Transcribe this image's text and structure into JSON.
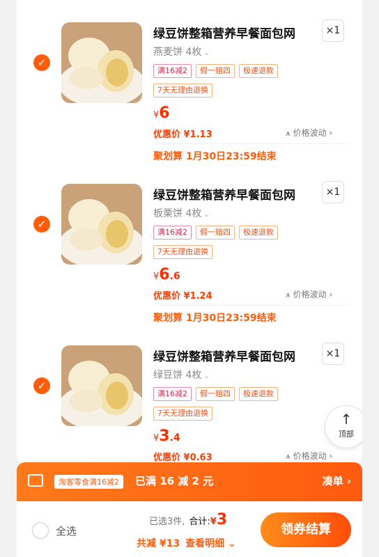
{
  "items": [
    {
      "title": "绿豆饼整箱营养早餐面包网",
      "qty": "×1",
      "variant": "燕麦饼 4枚",
      "tags": [
        "满16减2",
        "假一赔四",
        "极速退款"
      ],
      "return_tag": "7天无理由退换",
      "price_currency": "¥",
      "price_int": "6",
      "price_dec": "",
      "promo_price": "优惠价 ¥1.13",
      "fluct": "价格波动",
      "deadline": "聚划算 1月30日23:59结束"
    },
    {
      "title": "绿豆饼整箱营养早餐面包网",
      "qty": "×1",
      "variant": "板栗饼 4枚",
      "tags": [
        "满16减2",
        "假一赔四",
        "极速退款"
      ],
      "return_tag": "7天无理由退换",
      "price_currency": "¥",
      "price_int": "6",
      "price_dec": ".6",
      "promo_price": "优惠价 ¥1.24",
      "fluct": "价格波动",
      "deadline": "聚划算 1月30日23:59结束"
    },
    {
      "title": "绿豆饼整箱营养早餐面包网",
      "qty": "×1",
      "variant": "绿豆饼 4枚",
      "tags": [
        "满16减2",
        "假一赔四",
        "极速退款"
      ],
      "return_tag": "7天无理由退换",
      "price_currency": "¥",
      "price_int": "3",
      "price_dec": ".4",
      "promo_price": "优惠价 ¥0.63",
      "fluct": "价格波动"
    }
  ],
  "back_to_top": {
    "arrow": "↑",
    "label": "顶部"
  },
  "promo_bar": {
    "badge": "淘客零食满16减2",
    "status": "已满 16 减 2 元",
    "link": "凑单 ›"
  },
  "footer": {
    "select_all": "全选",
    "selected": "已选3件,",
    "total_label": "合计:",
    "total_currency": "¥",
    "total_value": "3",
    "savings": "共减 ¥13",
    "detail": "查看明细 ⌄",
    "checkout": "领券结算"
  },
  "colors": {
    "accent": "#ff5d0a",
    "price": "#ff2e00"
  },
  "icons": [
    "check-icon",
    "chevron-down-icon",
    "price-trend-icon",
    "coupon-icon",
    "arrow-up-icon"
  ]
}
